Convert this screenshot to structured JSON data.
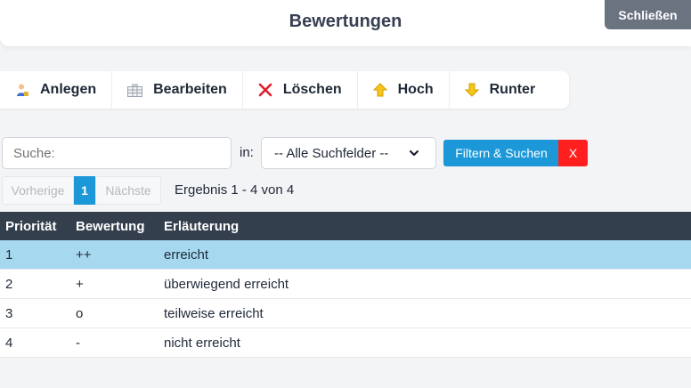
{
  "header": {
    "title": "Bewertungen",
    "close_label": "Schließen"
  },
  "toolbar": {
    "create_label": "Anlegen",
    "edit_label": "Bearbeiten",
    "delete_label": "Löschen",
    "up_label": "Hoch",
    "down_label": "Runter"
  },
  "search": {
    "placeholder": "Suche:",
    "in_label": "in:",
    "field_select": "-- Alle Suchfelder --",
    "filter_label": "Filtern & Suchen",
    "clear_label": "X"
  },
  "pager": {
    "prev_label": "Vorherige",
    "current_page": "1",
    "next_label": "Nächste",
    "result_text": "Ergebnis 1 - 4 von 4"
  },
  "table": {
    "columns": [
      "Priorität",
      "Bewertung",
      "Erläuterung"
    ],
    "rows": [
      [
        "1",
        "++",
        "erreicht"
      ],
      [
        "2",
        "+",
        "überwiegend erreicht"
      ],
      [
        "3",
        "o",
        "teilweise erreicht"
      ],
      [
        "4",
        "-",
        "nicht erreicht"
      ]
    ]
  },
  "icons": {
    "create": "user-add-icon",
    "edit": "grid-edit-icon",
    "delete": "red-x-icon",
    "up": "arrow-up-icon",
    "down": "arrow-down-icon"
  },
  "colors": {
    "accent": "#1c98d8",
    "danger": "#ff1f1f",
    "header_dark": "#343f4d",
    "selected_row": "#a6d9ef"
  }
}
